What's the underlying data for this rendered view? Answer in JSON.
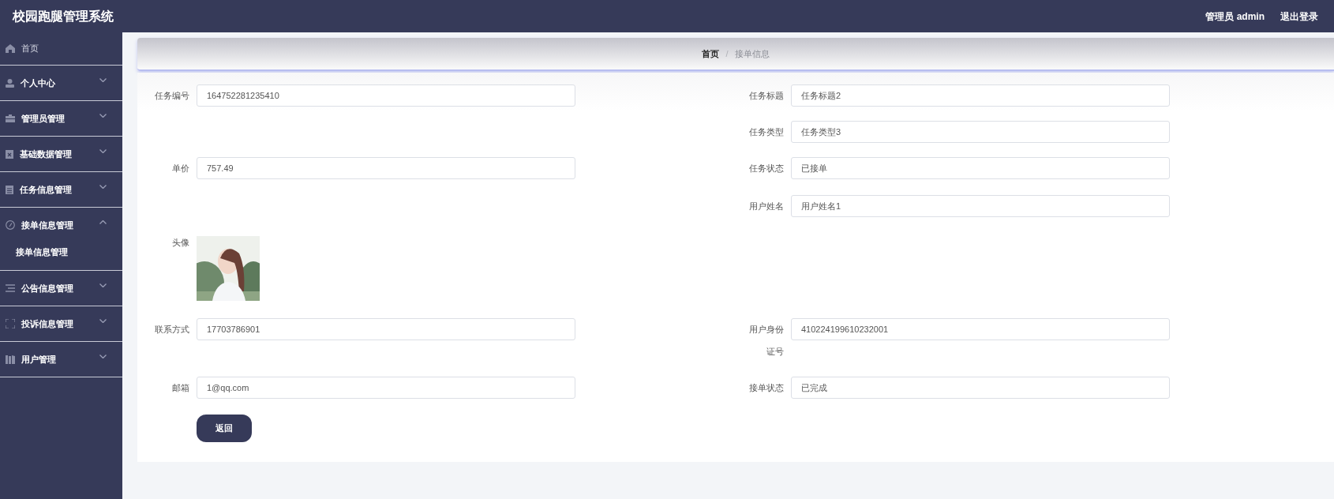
{
  "header": {
    "title": "校园跑腿管理系统",
    "user": "管理员 admin",
    "logout": "退出登录"
  },
  "sidebar": {
    "items": [
      {
        "label": "首页",
        "kind": "link"
      },
      {
        "label": "个人中心",
        "kind": "menu",
        "expanded": false
      },
      {
        "label": "管理员管理",
        "kind": "menu",
        "expanded": false
      },
      {
        "label": "基础数据管理",
        "kind": "menu",
        "expanded": false
      },
      {
        "label": "任务信息管理",
        "kind": "menu",
        "expanded": false
      },
      {
        "label": "接单信息管理",
        "kind": "menu",
        "expanded": true,
        "children": [
          {
            "label": "接单信息管理"
          }
        ]
      },
      {
        "label": "公告信息管理",
        "kind": "menu",
        "expanded": false
      },
      {
        "label": "投诉信息管理",
        "kind": "menu",
        "expanded": false
      },
      {
        "label": "用户管理",
        "kind": "menu",
        "expanded": false
      }
    ]
  },
  "breadcrumb": [
    "首页",
    "/",
    "接单信息"
  ],
  "form": {
    "rows": [
      {
        "left": {
          "label": "任务编号",
          "kind": "text",
          "value": "164752281235410"
        },
        "right": {
          "label": "任务标题",
          "kind": "text",
          "value": "任务标题2"
        }
      },
      {
        "right": {
          "label": "任务类型",
          "kind": "text",
          "value": "任务类型3"
        }
      },
      {
        "left": {
          "label": "单价",
          "kind": "text",
          "value": "757.49"
        },
        "right": {
          "label": "任务状态",
          "kind": "text",
          "value": "已接单"
        }
      },
      {
        "right": {
          "label": "用户姓名",
          "kind": "text",
          "value": "用户姓名1"
        }
      },
      {
        "left": {
          "label": "头像",
          "kind": "picture"
        }
      },
      {
        "left": {
          "label": "联系方式",
          "kind": "text",
          "value": "17703786901"
        },
        "right": {
          "label": "用户身份证号",
          "kind": "text",
          "value": "410224199610232001"
        }
      },
      {
        "left": {
          "label": "邮箱",
          "kind": "text",
          "value": "1@qq.com"
        },
        "right": {
          "label": "接单状态",
          "kind": "text",
          "value": "已完成"
        }
      }
    ],
    "back_button": "返回"
  }
}
